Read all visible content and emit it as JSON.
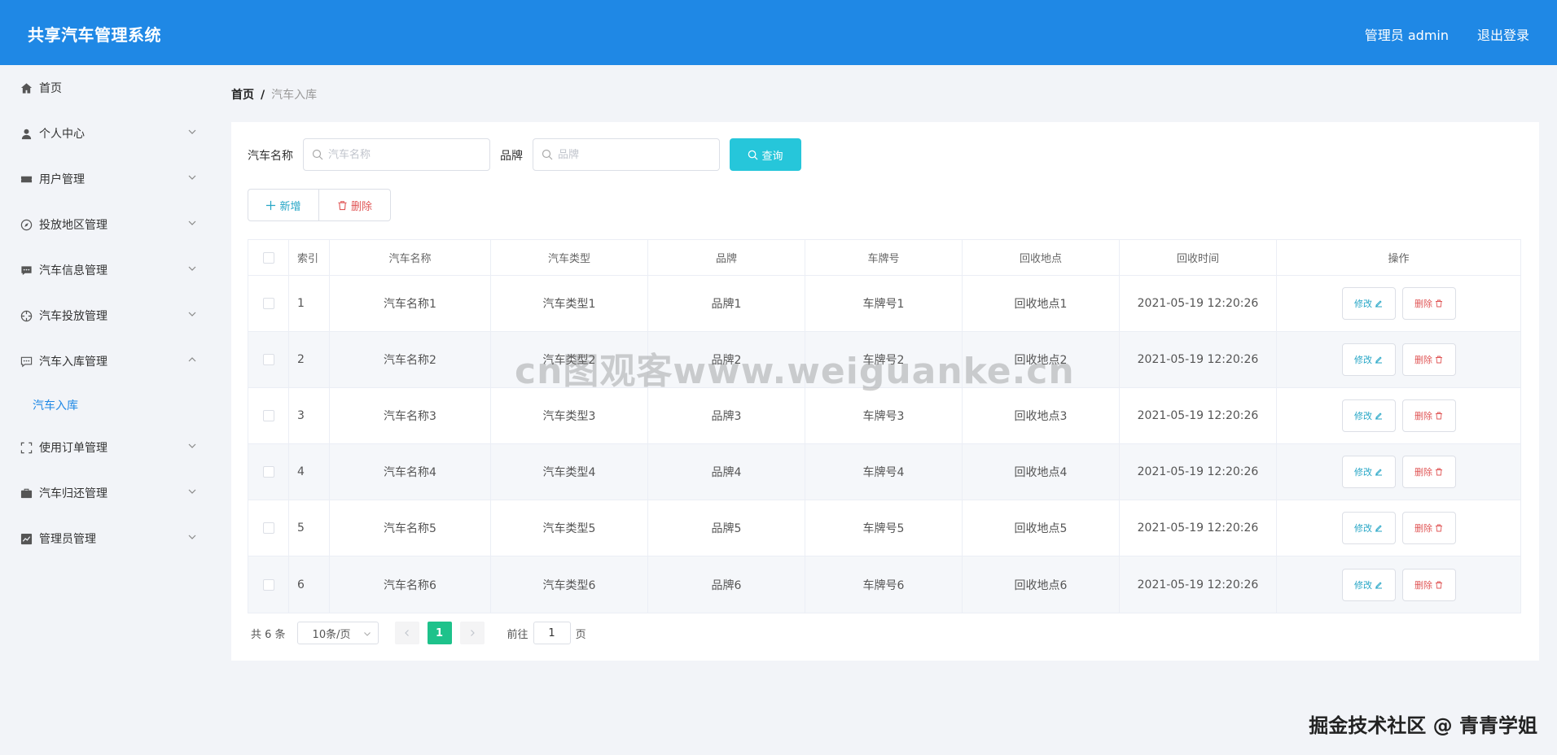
{
  "header": {
    "title": "共享汽车管理系统",
    "user": "管理员 admin",
    "logout": "退出登录"
  },
  "sidebar": {
    "items": [
      {
        "label": "首页",
        "icon": "home-icon"
      },
      {
        "label": "个人中心",
        "icon": "user-icon"
      },
      {
        "label": "用户管理",
        "icon": "ticket-icon"
      },
      {
        "label": "投放地区管理",
        "icon": "compass-icon"
      },
      {
        "label": "汽车信息管理",
        "icon": "message-icon"
      },
      {
        "label": "汽车投放管理",
        "icon": "target-icon"
      },
      {
        "label": "汽车入库管理",
        "icon": "chat-icon"
      },
      {
        "label": "使用订单管理",
        "icon": "fullscreen-icon"
      },
      {
        "label": "汽车归还管理",
        "icon": "briefcase-icon"
      },
      {
        "label": "管理员管理",
        "icon": "chart-icon"
      }
    ],
    "sub_item": "汽车入库"
  },
  "breadcrumb": {
    "home": "首页",
    "sep": "/",
    "current": "汽车入库"
  },
  "search": {
    "name_label": "汽车名称",
    "name_placeholder": "汽车名称",
    "brand_label": "品牌",
    "brand_placeholder": "品牌",
    "query": "查询"
  },
  "actions": {
    "add": "新增",
    "delete": "删除"
  },
  "table": {
    "headers": [
      "索引",
      "汽车名称",
      "汽车类型",
      "品牌",
      "车牌号",
      "回收地点",
      "回收时间",
      "操作"
    ],
    "rows": [
      [
        "1",
        "汽车名称1",
        "汽车类型1",
        "品牌1",
        "车牌号1",
        "回收地点1",
        "2021-05-19 12:20:26"
      ],
      [
        "2",
        "汽车名称2",
        "汽车类型2",
        "品牌2",
        "车牌号2",
        "回收地点2",
        "2021-05-19 12:20:26"
      ],
      [
        "3",
        "汽车名称3",
        "汽车类型3",
        "品牌3",
        "车牌号3",
        "回收地点3",
        "2021-05-19 12:20:26"
      ],
      [
        "4",
        "汽车名称4",
        "汽车类型4",
        "品牌4",
        "车牌号4",
        "回收地点4",
        "2021-05-19 12:20:26"
      ],
      [
        "5",
        "汽车名称5",
        "汽车类型5",
        "品牌5",
        "车牌号5",
        "回收地点5",
        "2021-05-19 12:20:26"
      ],
      [
        "6",
        "汽车名称6",
        "汽车类型6",
        "品牌6",
        "车牌号6",
        "回收地点6",
        "2021-05-19 12:20:26"
      ]
    ],
    "edit": "修改",
    "delete": "删除"
  },
  "pager": {
    "total": "共 6 条",
    "size": "10条/页",
    "page": "1",
    "goto": "前往",
    "goto_value": "1",
    "unit": "页"
  },
  "watermark": "cn图观客www.weiguanke.cn",
  "credit": "掘金技术社区 @ 青青学姐",
  "colors": {
    "header": "#1f88e5",
    "query": "#26c6da",
    "active_page": "#1ec28b",
    "danger": "#e05656"
  }
}
